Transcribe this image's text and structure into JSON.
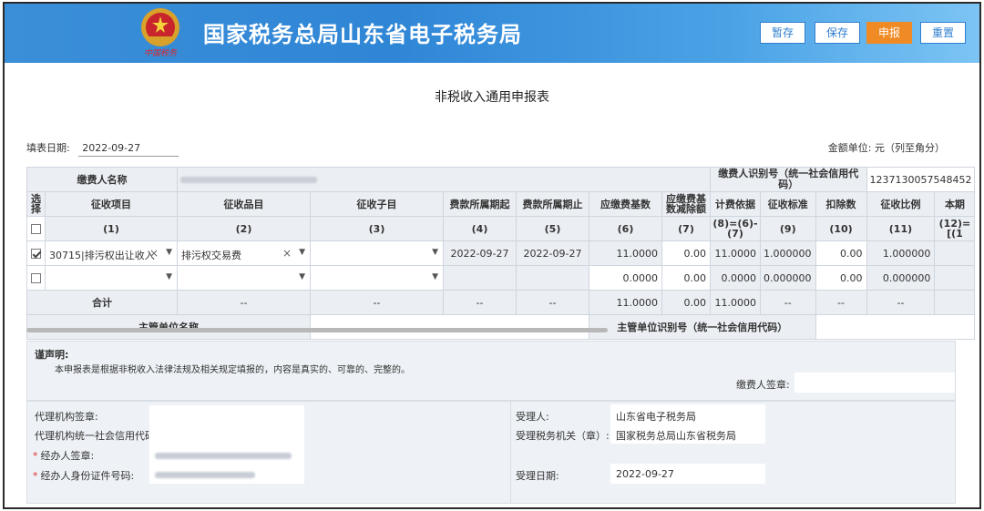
{
  "header": {
    "title": "国家税务总局山东省电子税务局",
    "emblem_text": "中国税务",
    "buttons": {
      "temp_save": "暂存",
      "save": "保存",
      "declare": "申报",
      "reset": "重置"
    }
  },
  "form": {
    "title": "非税收入通用申报表",
    "fill_date_label": "填表日期:",
    "fill_date": "2022-09-27",
    "amount_unit": "金额单位: 元（列至角分）"
  },
  "grid": {
    "payer_name_label": "缴费人名称",
    "payer_id_label": "缴费人识别号（统一社会信用代码）",
    "payer_id_value": "1237130057548452",
    "col_headers": [
      "选择",
      "征收项目",
      "征收品目",
      "征收子目",
      "费款所属期起",
      "费款所属期止",
      "应缴费基数",
      "应缴费基数减除额",
      "计费依据",
      "征收标准",
      "扣除数",
      "征收比例",
      "本期"
    ],
    "col_numbers": [
      "(1)",
      "(2)",
      "(3)",
      "(4)",
      "(5)",
      "(6)",
      "(7)",
      "(8)=(6)-(7)",
      "(9)",
      "(10)",
      "(11)",
      "(12)=[(1"
    ],
    "rows": [
      {
        "item": "30715|排污权出让收入",
        "subitem": "排污权交易费",
        "sub": "",
        "start": "2022-09-27",
        "end": "2022-09-27",
        "base": "11.0000",
        "deduct": "0.00",
        "basis": "11.0000",
        "standard": "1.000000",
        "deduct_num": "0.00",
        "ratio": "1.000000"
      },
      {
        "item": "",
        "subitem": "",
        "sub": "",
        "start": "",
        "end": "",
        "base": "0.0000",
        "deduct": "0.00",
        "basis": "0.0000",
        "standard": "0.000000",
        "deduct_num": "0.00",
        "ratio": "0.000000"
      }
    ],
    "total": {
      "label": "合计",
      "dash": "--",
      "base": "11.0000",
      "deduct": "0.00",
      "basis": "11.0000"
    },
    "supervisor_name_label": "主管单位名称",
    "supervisor_id_label": "主管单位识别号（统一社会信用代码）"
  },
  "declaration": {
    "title": "谨声明:",
    "text": "本申报表是根据非税收入法律法规及相关规定填报的，内容是真实的、可靠的、完整的。",
    "payer_signature_label": "缴费人签章:"
  },
  "bottom": {
    "agent_seal_label": "代理机构签章:",
    "agent_credit_label": "代理机构统一社会信用代码:",
    "handler_sign_label": "经办人签章:",
    "handler_id_label": "经办人身份证件号码:",
    "receiver_label": "受理人:",
    "receiver_value": "山东省电子税务局",
    "receiving_office_label": "受理税务机关（章）:",
    "receiving_office_value": "国家税务总局山东省税务局",
    "receive_date_label": "受理日期:",
    "receive_date_value": "2022-09-27"
  },
  "colors": {
    "header_blue": "#2f86d6",
    "declare_orange": "#f08a24"
  }
}
